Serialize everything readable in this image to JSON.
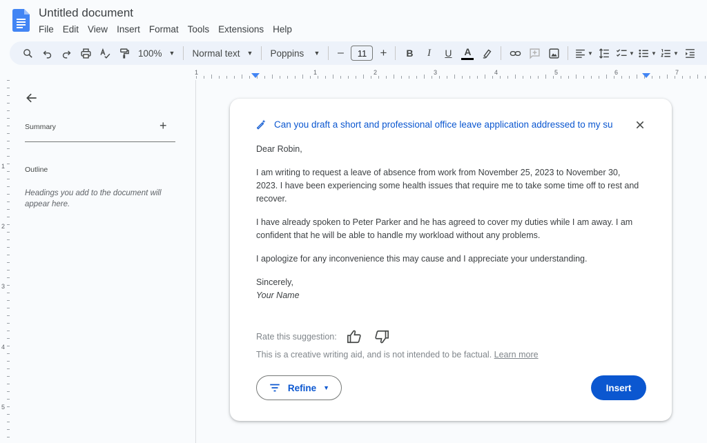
{
  "app": {
    "title": "Untitled document",
    "menu": [
      "File",
      "Edit",
      "View",
      "Insert",
      "Format",
      "Tools",
      "Extensions",
      "Help"
    ]
  },
  "toolbar": {
    "zoom": "100%",
    "style": "Normal text",
    "font": "Poppins",
    "font_size": "11",
    "minus": "–",
    "plus": "+",
    "bold": "B",
    "italic": "I",
    "underline": "U",
    "text_color": "A"
  },
  "ruler": {
    "numbers": [
      "1",
      "1",
      "2",
      "3",
      "4",
      "5",
      "6",
      "7"
    ],
    "vertical_numbers": [
      "1",
      "2",
      "3",
      "4",
      "5"
    ]
  },
  "sidebar": {
    "summary_label": "Summary",
    "summary_add": "+",
    "outline_label": "Outline",
    "outline_hint": "Headings you add to the document will appear here."
  },
  "card": {
    "prompt": "Can you draft a short and professional office leave application addressed to my su",
    "letter": {
      "greeting": "Dear Robin,",
      "paragraph1": "I am writing to request a leave of absence from work from November 25, 2023 to November 30, 2023. I have been experiencing some health issues that require me to take some time off to rest and recover.",
      "paragraph2": "I have already spoken to Peter Parker and he has agreed to cover my duties while I am away. I am confident that he will be able to handle my workload without any problems.",
      "paragraph3": "I apologize for any inconvenience this may cause and I appreciate your understanding.",
      "closing": "Sincerely,",
      "name": "Your Name"
    },
    "rate_label": "Rate this suggestion:",
    "disclaimer": "This is a creative writing aid, and is not intended to be factual.",
    "learn_more": "Learn more",
    "refine_label": "Refine",
    "insert_label": "Insert"
  },
  "colors": {
    "accent": "#0b57d0",
    "toolbar_bg": "#edf2fa",
    "doc_icon": "#4285f4"
  }
}
